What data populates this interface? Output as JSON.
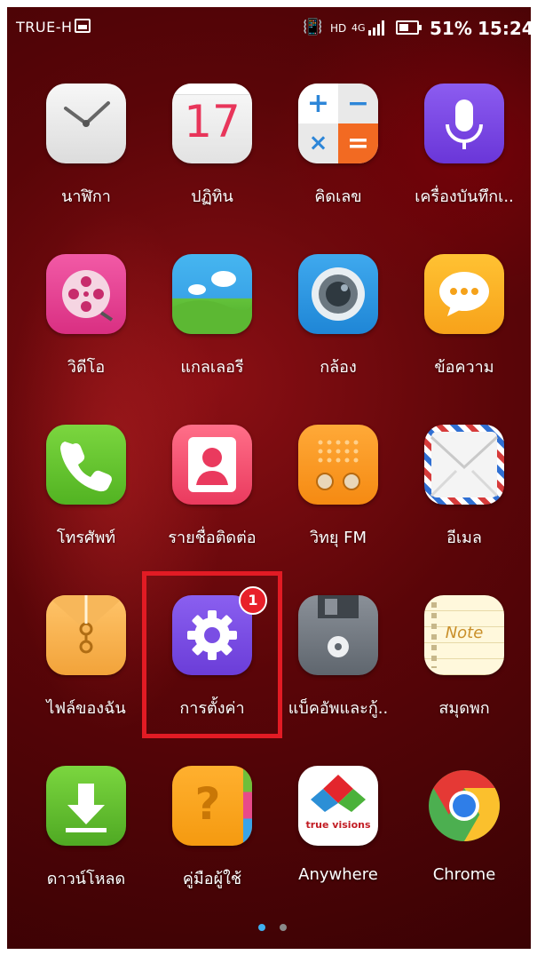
{
  "status_bar": {
    "carrier": "TRUE-H",
    "network_hd": "HD",
    "network_type": "4G",
    "battery_percent": "51%",
    "time": "15:24"
  },
  "apps": [
    {
      "label": "นาฬิกา",
      "icon": "clock-icon"
    },
    {
      "label": "ปฏิทิน",
      "icon": "calendar-icon",
      "icon_text": "17"
    },
    {
      "label": "คิดเลข",
      "icon": "calculator-icon"
    },
    {
      "label": "เครื่องบันทึกเ..",
      "icon": "microphone-icon"
    },
    {
      "label": "วิดีโอ",
      "icon": "film-reel-icon"
    },
    {
      "label": "แกลเลอรี",
      "icon": "gallery-icon"
    },
    {
      "label": "กล้อง",
      "icon": "camera-icon"
    },
    {
      "label": "ข้อความ",
      "icon": "message-bubble-icon"
    },
    {
      "label": "โทรศัพท์",
      "icon": "phone-icon"
    },
    {
      "label": "รายชื่อติดต่อ",
      "icon": "contact-icon"
    },
    {
      "label": "วิทยุ FM",
      "icon": "radio-icon"
    },
    {
      "label": "อีเมล",
      "icon": "envelope-icon"
    },
    {
      "label": "ไฟล์ของฉัน",
      "icon": "folder-icon"
    },
    {
      "label": "การตั้งค่า",
      "icon": "gear-icon",
      "badge": "1"
    },
    {
      "label": "แบ็คอัพและกู้..",
      "icon": "floppy-disk-icon"
    },
    {
      "label": "สมุดพก",
      "icon": "notepad-icon",
      "icon_text": "Note"
    },
    {
      "label": "ดาวน์โหลด",
      "icon": "download-icon"
    },
    {
      "label": "คู่มือผู้ใช้",
      "icon": "help-book-icon",
      "icon_text": "?"
    },
    {
      "label": "Anywhere",
      "icon": "truevisions-icon",
      "icon_text": "true visions"
    },
    {
      "label": "Chrome",
      "icon": "chrome-icon"
    }
  ],
  "page_indicator": {
    "current": 1,
    "total": 2
  },
  "colors": {
    "highlight": "#e21b24",
    "badge": "#e8202a"
  }
}
